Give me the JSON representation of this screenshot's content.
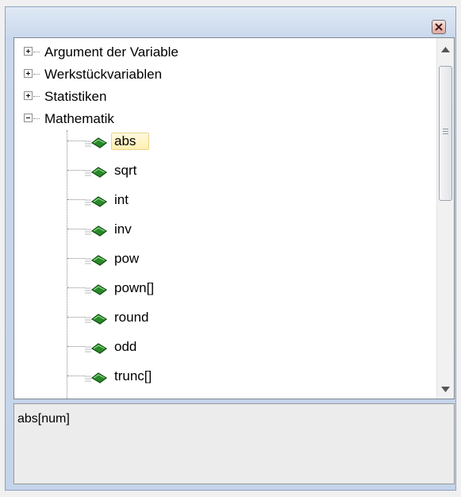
{
  "tree": {
    "categories": [
      {
        "label": "Argument der Variable",
        "expanded": false
      },
      {
        "label": "Werkstückvariablen",
        "expanded": false
      },
      {
        "label": "Statistiken",
        "expanded": false
      },
      {
        "label": "Mathematik",
        "expanded": true
      }
    ],
    "functions": [
      "abs",
      "sqrt",
      "int",
      "inv",
      "pow",
      "pown[]",
      "round",
      "odd",
      "trunc[]"
    ],
    "selected": "abs"
  },
  "description": {
    "text": "abs[num]"
  },
  "colors": {
    "selection": "#ffefb0",
    "title_bar": "#c9d8ec",
    "close_button": "#e0a9a0",
    "function_icon": "#2a8a2a"
  },
  "icons": {
    "close": "close-icon",
    "function": "function-icon",
    "expand": "plus-box-icon",
    "collapse": "minus-box-icon"
  }
}
